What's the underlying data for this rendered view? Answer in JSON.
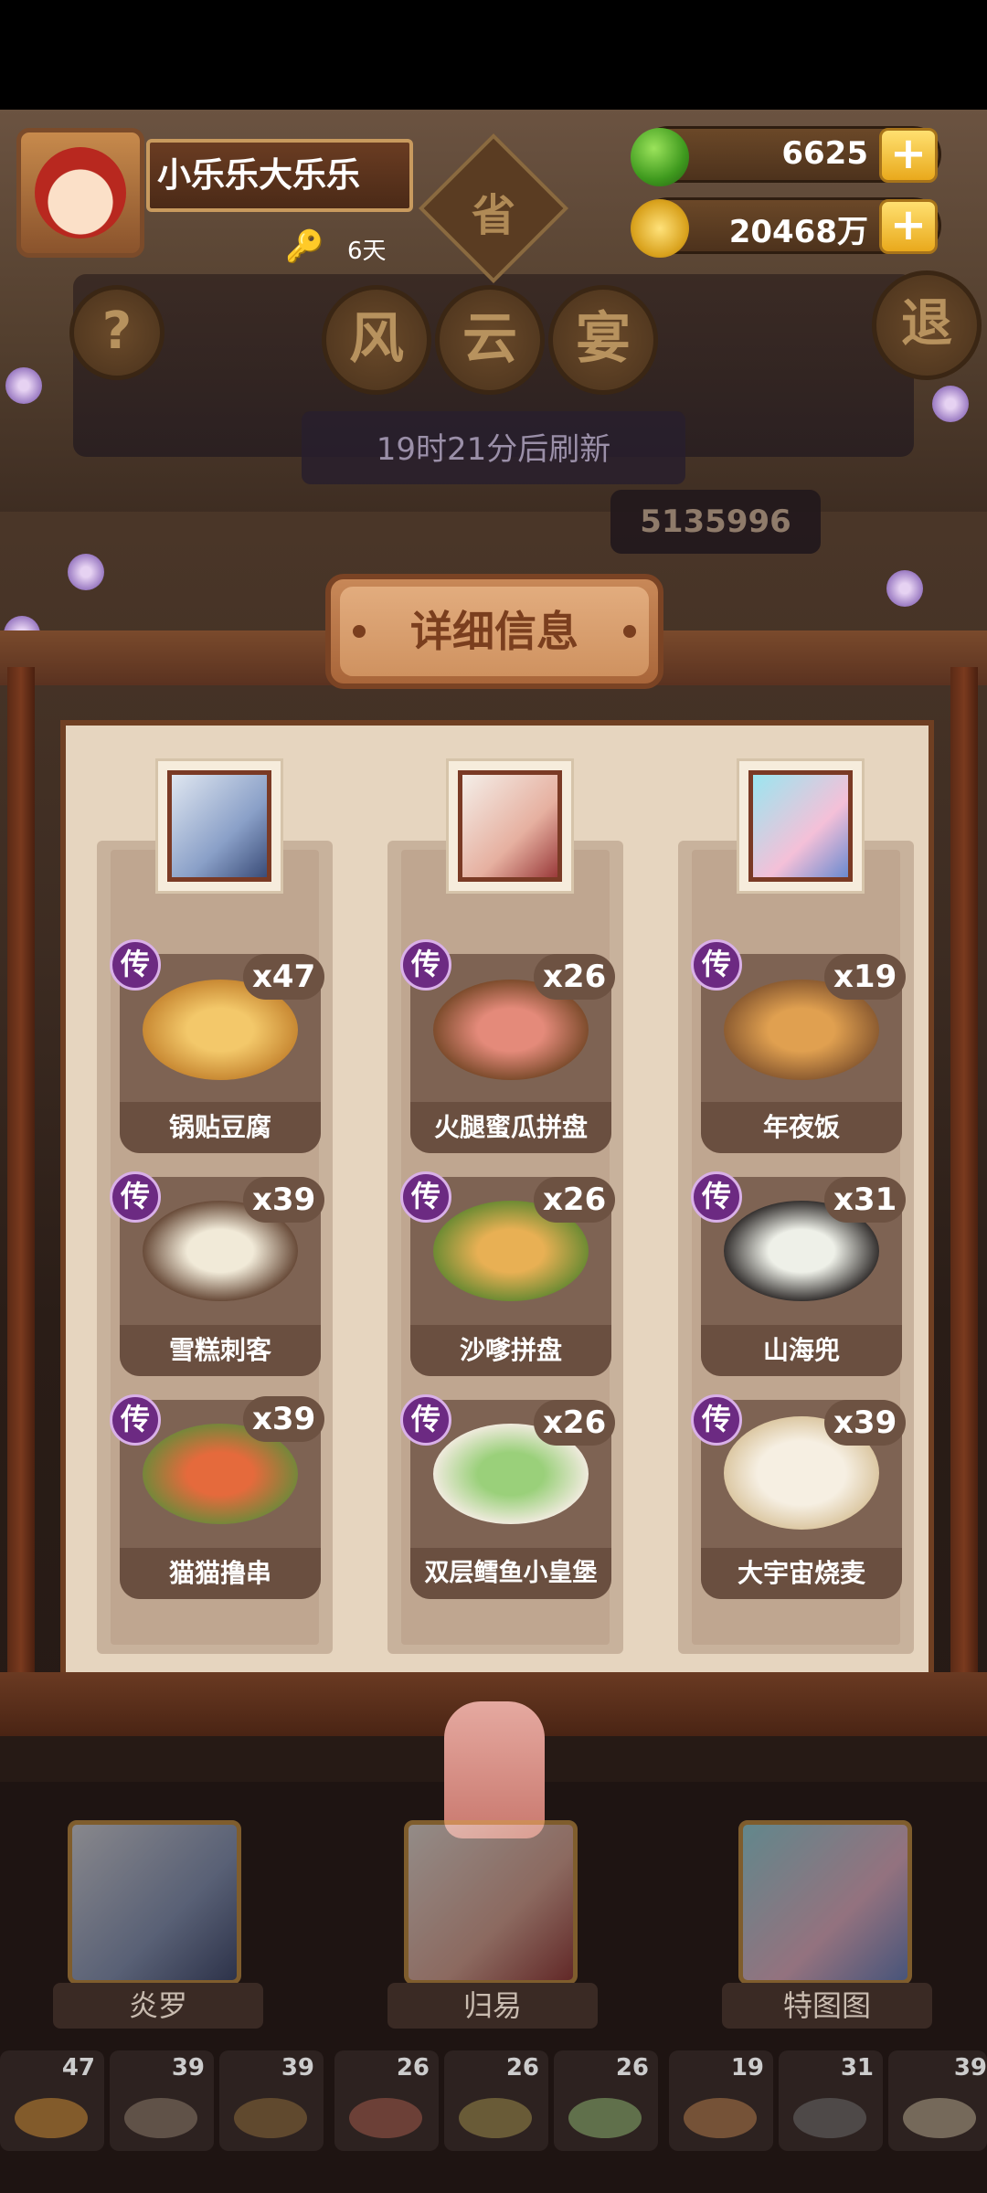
{
  "header": {
    "player_name": "小乐乐大乐乐",
    "days": "6天",
    "province_char": "省",
    "jade_value": "6625",
    "coin_value": "20468万",
    "plus_label": "+",
    "help_label": "?",
    "exit_label": "退",
    "title_chars": [
      "风",
      "云",
      "宴"
    ],
    "refresh_text": "19时21分后刷新",
    "score": "5135996"
  },
  "board": {
    "detail_title": "详细信息",
    "legend_badge": "传",
    "columns": [
      {
        "dishes": [
          {
            "name": "锅贴豆腐",
            "count": "x47"
          },
          {
            "name": "雪糕刺客",
            "count": "x39"
          },
          {
            "name": "猫猫撸串",
            "count": "x39"
          }
        ]
      },
      {
        "dishes": [
          {
            "name": "火腿蜜瓜拼盘",
            "count": "x26"
          },
          {
            "name": "沙嗲拼盘",
            "count": "x26"
          },
          {
            "name": "双层鳕鱼小皇堡",
            "count": "x26"
          }
        ]
      },
      {
        "dishes": [
          {
            "name": "年夜饭",
            "count": "x19"
          },
          {
            "name": "山海兜",
            "count": "x31"
          },
          {
            "name": "大宇宙烧麦",
            "count": "x39"
          }
        ]
      }
    ]
  },
  "characters": [
    "炎罗",
    "归易",
    "特图图"
  ],
  "food_slots": [
    "47",
    "39",
    "39",
    "26",
    "26",
    "26",
    "19",
    "31",
    "39"
  ],
  "colors": {
    "legend_purple": "#6c2a82",
    "board_bg": "#e6d5bf",
    "frame_brown": "#6f3f22"
  }
}
